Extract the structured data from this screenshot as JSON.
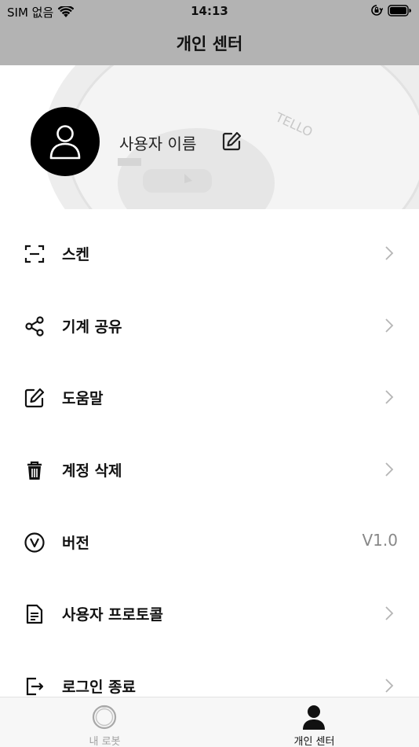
{
  "status_bar": {
    "carrier": "SIM 없음",
    "time": "14:13",
    "icons": [
      "wifi-icon",
      "orientation-lock-icon",
      "battery-icon"
    ]
  },
  "nav": {
    "title": "개인 센터"
  },
  "profile": {
    "username": "사용자 이름",
    "avatar_icon": "user-icon",
    "edit_icon": "edit-icon",
    "background_text": "TELLO"
  },
  "menu": {
    "items": [
      {
        "label": "스켄",
        "icon": "scan-icon",
        "chevron": true
      },
      {
        "label": "기계 공유",
        "icon": "share-icon",
        "chevron": true
      },
      {
        "label": "도움말",
        "icon": "edit-icon",
        "chevron": true
      },
      {
        "label": "계정 삭제",
        "icon": "trash-icon",
        "chevron": true
      },
      {
        "label": "버전",
        "icon": "version-icon",
        "value": "V1.0"
      },
      {
        "label": "사용자 프로토콜",
        "icon": "document-icon",
        "chevron": true
      },
      {
        "label": "로그인 종료",
        "icon": "logout-icon",
        "chevron": true
      }
    ]
  },
  "tab_bar": {
    "tabs": [
      {
        "label": "내 로봇",
        "icon": "robot-icon",
        "active": false
      },
      {
        "label": "개인 센터",
        "icon": "person-icon",
        "active": true
      }
    ]
  },
  "colors": {
    "header_bg": "#b3b3b3",
    "tab_bar_bg": "#f7f7f7",
    "inactive_tab": "#a0a0a0"
  }
}
